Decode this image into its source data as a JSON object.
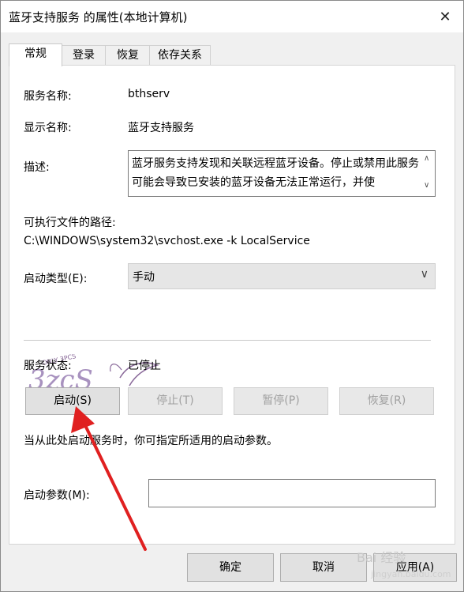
{
  "window": {
    "title": "蓝牙支持服务 的属性(本地计算机)"
  },
  "tabs": [
    {
      "label": "常规",
      "active": true
    },
    {
      "label": "登录",
      "active": false
    },
    {
      "label": "恢复",
      "active": false
    },
    {
      "label": "依存关系",
      "active": false
    }
  ],
  "general": {
    "service_name_label": "服务名称:",
    "service_name_value": "bthserv",
    "display_name_label": "显示名称:",
    "display_name_value": "蓝牙支持服务",
    "description_label": "描述:",
    "description_value": "蓝牙服务支持发现和关联远程蓝牙设备。停止或禁用此服务可能会导致已安装的蓝牙设备无法正常运行，并使",
    "path_label": "可执行文件的路径:",
    "path_value": "C:\\WINDOWS\\system32\\svchost.exe -k LocalService",
    "startup_type_label": "启动类型(E):",
    "startup_type_value": "手动",
    "status_label": "服务状态:",
    "status_value": "已停止",
    "buttons": {
      "start": "启动(S)",
      "stop": "停止(T)",
      "pause": "暂停(P)",
      "resume": "恢复(R)"
    },
    "hint": "当从此处启动服务时，你可指定所适用的启动参数。",
    "params_label": "启动参数(M):",
    "params_value": ""
  },
  "footer": {
    "ok": "确定",
    "cancel": "取消",
    "apply": "应用(A)"
  },
  "watermark": {
    "text": "Bai 经验",
    "sub": "jingyan.baidu.com"
  },
  "logo_text": "ONLY 3PCS 3ZCS",
  "annotation": {
    "arrow_color": "#e02020"
  }
}
